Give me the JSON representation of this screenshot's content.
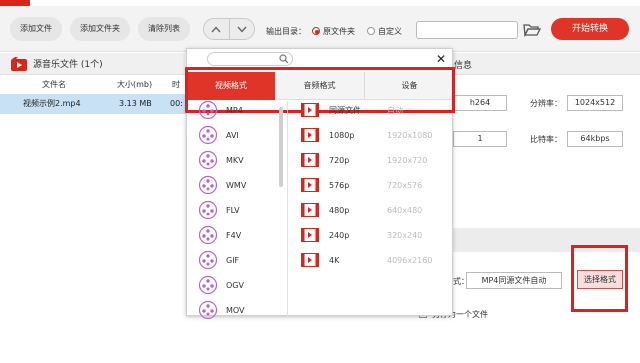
{
  "toolbar": {
    "add_file": "添加文件",
    "add_folder": "添加文件夹",
    "clear_list": "清除列表",
    "output_dir_label": "输出目录：",
    "radio_source_folder": "原文件夹",
    "radio_custom": "自定义",
    "output_path_value": "",
    "start_button": "开始转换"
  },
  "left_panel": {
    "header": "源音乐文件 (1个)",
    "columns": [
      "文件名",
      "大小(mb)",
      "时"
    ],
    "files": [
      {
        "name": "视频示例2.mp4",
        "size": "3.13 MB",
        "duration": "00:"
      }
    ]
  },
  "right_panel": {
    "header": "信息",
    "encoder_value": "h264",
    "resolution_label": "分辨率：",
    "resolution_value": "1024x512",
    "channels_value": "1",
    "bitrate_label": "比特率：",
    "bitrate_value": "64kbps",
    "format_label_partial": "式：",
    "format_value": "MP4同源文件自动",
    "choose_format_button": "选择格式",
    "save_as_partial": "另存为一个文件"
  },
  "format_popup": {
    "search_placeholder": "",
    "close_symbol": "✕",
    "tabs": [
      "视频格式",
      "音频格式",
      "设备"
    ],
    "active_tab": 0,
    "formats": [
      "MP4",
      "AVI",
      "MKV",
      "WMV",
      "FLV",
      "F4V",
      "GIF",
      "OGV",
      "MOV"
    ],
    "resolutions": [
      {
        "name": "同源文件",
        "dim": "自动"
      },
      {
        "name": "1080p",
        "dim": "1920x1080"
      },
      {
        "name": "720p",
        "dim": "1920x720"
      },
      {
        "name": "576p",
        "dim": "720x576"
      },
      {
        "name": "480p",
        "dim": "640x480"
      },
      {
        "name": "240p",
        "dim": "320x240"
      },
      {
        "name": "4K",
        "dim": "4096x2160"
      }
    ]
  },
  "colors": {
    "accent": "#e03428",
    "highlight_frame": "#e02020",
    "selection_row": "#c9e1f5",
    "format_icon": "#b368c9",
    "film_icon": "#d9261c"
  }
}
